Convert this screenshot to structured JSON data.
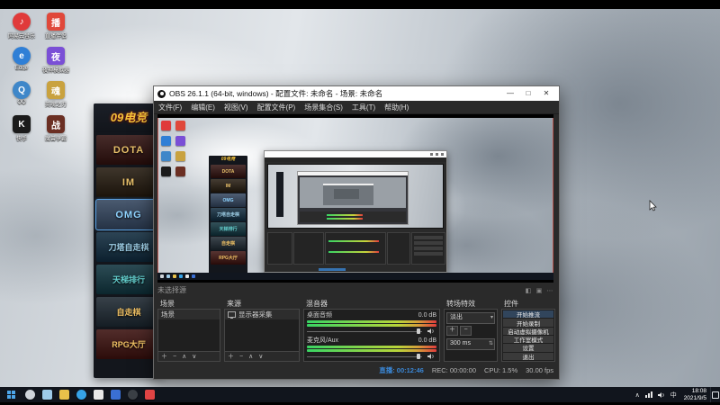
{
  "colors": {
    "accent_live": "#3a86d4",
    "meter_low": "#39d463",
    "meter_high": "#e03c3c",
    "taskbar_bg": "#11151d",
    "selected_tile_border": "#5aa0e0"
  },
  "desktop": {
    "icons": [
      {
        "name": "netease-music",
        "glyph": "♪",
        "label": "网易云音乐",
        "color": "#e03a3a",
        "round": true
      },
      {
        "name": "live-companion",
        "glyph": "播",
        "label": "直播伴侣",
        "color": "#e0483a",
        "round": false
      },
      {
        "name": "edge-browser",
        "glyph": "e",
        "label": "Edge",
        "color": "#2f7fd6",
        "round": true
      },
      {
        "name": "emulator",
        "glyph": "夜",
        "label": "夜神模拟器",
        "color": "#7a4fd6",
        "round": false
      },
      {
        "name": "qq",
        "glyph": "Q",
        "label": "QQ",
        "color": "#3f87c9",
        "round": true
      },
      {
        "name": "game-client",
        "glyph": "魂",
        "label": "英魂之刃",
        "color": "#c9a23f",
        "round": false
      },
      {
        "name": "kuaishou",
        "glyph": "K",
        "label": "快手",
        "color": "#1b1b1b",
        "round": false
      },
      {
        "name": "war-game",
        "glyph": "战",
        "label": "魔兽争霸",
        "color": "#6b2f23",
        "round": false
      }
    ]
  },
  "game_panel": {
    "logo": "09电竞",
    "tiles": [
      {
        "label": "DOTA",
        "bg": "#2e0f0d",
        "fg": "#e8c06a"
      },
      {
        "label": "IM",
        "bg": "#241a0e",
        "fg": "#e8c06a"
      },
      {
        "label": "OMG",
        "bg": "#31435c",
        "fg": "#8fd4ff",
        "selected": true
      },
      {
        "label": "刀塔自走棋",
        "bg": "#0f2a3d",
        "fg": "#9fd0e8"
      },
      {
        "label": "天梯排行",
        "bg": "#0f333d",
        "fg": "#64d0cf"
      },
      {
        "label": "自走棋",
        "bg": "#1c2730",
        "fg": "#f0c164"
      },
      {
        "label": "RPG大厅",
        "bg": "#3a100d",
        "fg": "#f0c164"
      }
    ]
  },
  "obs": {
    "window_title": "OBS 26.1.1 (64-bit, windows) - 配置文件: 未命名 - 场景: 未命名",
    "window_buttons": {
      "minimize": "—",
      "maximize": "□",
      "close": "✕"
    },
    "menu": [
      "文件(F)",
      "编辑(E)",
      "视图(V)",
      "配置文件(P)",
      "场景集合(S)",
      "工具(T)",
      "帮助(H)"
    ],
    "preview_hint": "未选择源",
    "scenes_dock": {
      "title": "场景",
      "items": [
        "场景"
      ],
      "toolbar": [
        "＋",
        "−",
        "∧",
        "∨"
      ]
    },
    "sources_dock": {
      "title": "来源",
      "items": [
        "显示器采集"
      ],
      "toolbar": [
        "＋",
        "−",
        "∧",
        "∨"
      ]
    },
    "mixer_dock": {
      "title": "混音器",
      "channels": [
        {
          "name": "桌面音频",
          "db": "0.0 dB"
        },
        {
          "name": "麦克风/Aux",
          "db": "0.0 dB"
        }
      ]
    },
    "transitions_dock": {
      "title": "转场特效",
      "transition": "淡出",
      "duration": "300 ms"
    },
    "controls_dock": {
      "title": "控件",
      "buttons": [
        "开始推流",
        "开始录制",
        "启动虚拟摄像机",
        "工作室模式",
        "设置",
        "退出"
      ]
    },
    "statusbar": {
      "live": "直播: 00:12:46",
      "rec": "REC: 00:00:00",
      "cpu": "CPU: 1.5%",
      "fps": "30.00 fps"
    }
  },
  "taskbar": {
    "time": "18:08",
    "date": "2021/9/5",
    "apps": [
      {
        "name": "search",
        "color": "#cfd4da"
      },
      {
        "name": "task-view",
        "color": "#9ecbe8"
      },
      {
        "name": "file-explorer",
        "color": "#e8c14a"
      },
      {
        "name": "edge",
        "color": "#36a3e8"
      },
      {
        "name": "store",
        "color": "#e8e8e8"
      },
      {
        "name": "photos",
        "color": "#3a6fd4"
      },
      {
        "name": "obs-app",
        "color": "#3a3f45"
      },
      {
        "name": "live-companion-app",
        "color": "#e04444"
      }
    ],
    "tray": [
      {
        "name": "tray-chevron",
        "glyph": "∧"
      },
      {
        "name": "tray-ime",
        "glyph": "中"
      }
    ]
  }
}
